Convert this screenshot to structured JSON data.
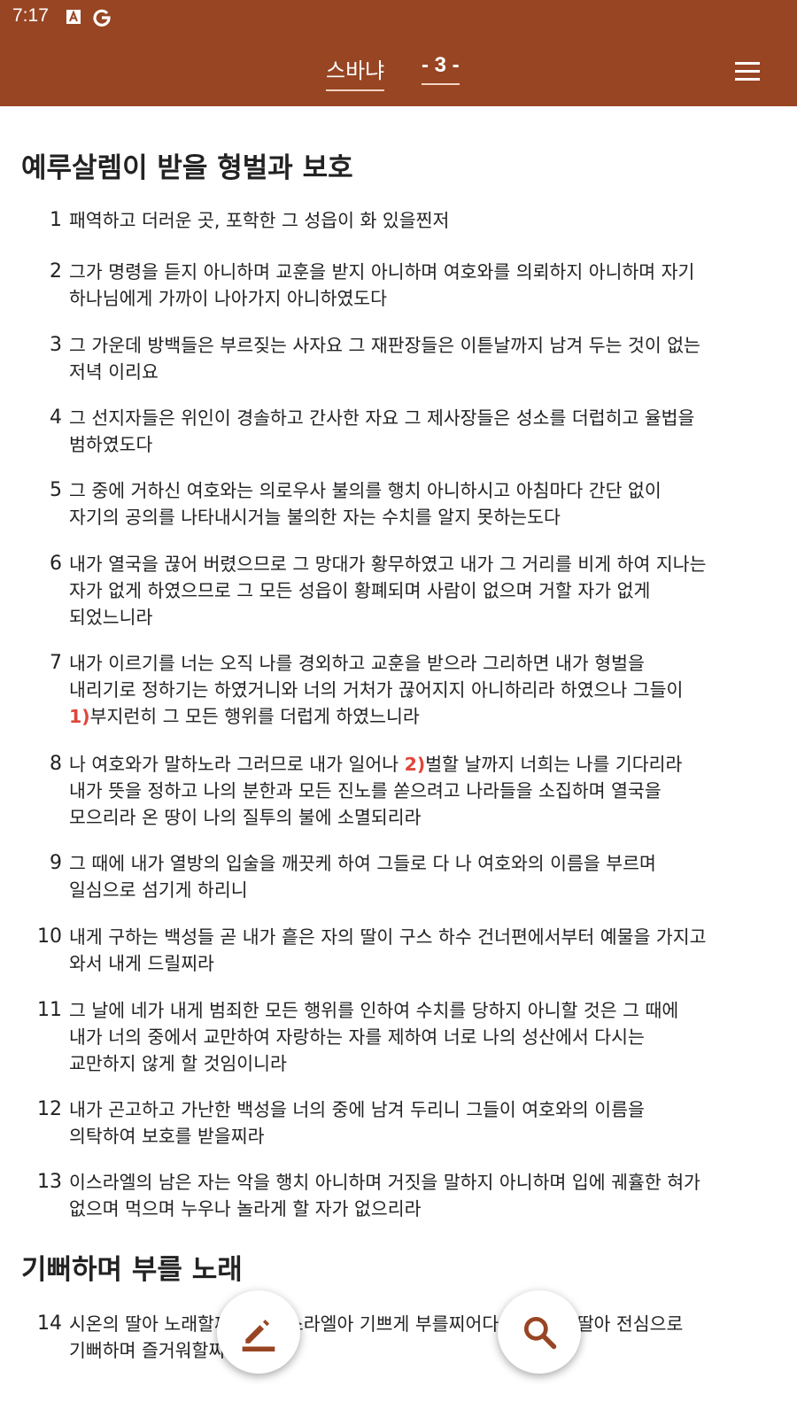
{
  "status_bar": {
    "time": "7:17"
  },
  "header": {
    "book": "스바냐",
    "chapter": "- 3 -"
  },
  "sections": [
    {
      "heading": "예루살렘이 받을 형벌과 보호",
      "verses": [
        {
          "num": "1",
          "lines": [
            "패역하고 더러운 곳, 포학한 그 성읍이 화 있을찐저"
          ]
        },
        {
          "num": "2",
          "lines": [
            "그가 명령을 듣지 아니하며 교훈을 받지 아니하며 여호와를 의뢰하지 아니하며 자기",
            "하나님에게 가까이 나아가지 아니하였도다"
          ]
        },
        {
          "num": "3",
          "lines": [
            "그 가운데 방백들은 부르짖는 사자요 그 재판장들은 이튿날까지 남겨 두는 것이 없는",
            "저녁 이리요"
          ]
        },
        {
          "num": "4",
          "lines": [
            "그 선지자들은 위인이 경솔하고 간사한 자요 그 제사장들은 성소를 더럽히고 율법을",
            "범하였도다"
          ]
        },
        {
          "num": "5",
          "lines": [
            "그 중에 거하신 여호와는 의로우사 불의를 행치 아니하시고 아침마다 간단 없이",
            "자기의 공의를 나타내시거늘 불의한 자는 수치를 알지 못하는도다"
          ]
        },
        {
          "num": "6",
          "lines": [
            "내가 열국을 끊어 버렸으므로 그 망대가 황무하였고 내가 그 거리를 비게 하여 지나는",
            "자가 없게 하였으므로 그 모든 성읍이 황폐되며 사람이 없으며 거할 자가 없게",
            "되었느니라"
          ]
        },
        {
          "num": "7",
          "lines": [
            "내가 이르기를 너는 오직 나를 경외하고 교훈을 받으라 그리하면 내가 형벌을",
            "내리기로 정하기는 하였거니와 너의 거처가 끊어지지 아니하리라 하였으나 그들이"
          ],
          "fn_mark": "1)",
          "fn_line": "부지런히 그 모든 행위를 더럽게 하였느니라"
        },
        {
          "num": "8",
          "pre": "나 여호와가 말하노라 그러므로 내가 일어나 ",
          "fn_mark": "2)",
          "post": "벌할 날까지 너희는 나를 기다리라",
          "lines": [
            "내가 뜻을 정하고 나의 분한과 모든 진노를 쏟으려고 나라들을 소집하며 열국을",
            "모으리라 온 땅이 나의 질투의 불에 소멸되리라"
          ]
        },
        {
          "num": "9",
          "lines": [
            "그 때에 내가 열방의 입술을 깨끗케 하여 그들로 다 나 여호와의 이름을 부르며",
            "일심으로 섬기게 하리니"
          ]
        },
        {
          "num": "10",
          "lines": [
            "내게 구하는 백성들 곧 내가 흩은 자의 딸이 구스 하수 건너편에서부터 예물을 가지고",
            "와서 내게 드릴찌라"
          ]
        },
        {
          "num": "11",
          "lines": [
            "그 날에 네가 내게 범죄한 모든 행위를 인하여 수치를 당하지 아니할 것은 그 때에",
            "내가 너의 중에서 교만하여 자랑하는 자를 제하여 너로 나의 성산에서 다시는",
            "교만하지 않게 할 것임이니라"
          ]
        },
        {
          "num": "12",
          "lines": [
            "내가 곤고하고 가난한 백성을 너의 중에 남겨 두리니 그들이 여호와의 이름을",
            "의탁하여 보호를 받을찌라"
          ]
        },
        {
          "num": "13",
          "lines": [
            "이스라엘의 남은 자는 악을 행치 아니하며 거짓을 말하지 아니하며 입에 궤휼한 혀가",
            "없으며 먹으며 누우나 놀라게 할 자가 없으리라"
          ]
        }
      ]
    },
    {
      "heading": "기뻐하며 부를 노래",
      "verses": [
        {
          "num": "14",
          "lines": [
            "시온의 딸아 노래할찌어다 이스라엘아 기쁘게 부를찌어다 예루살렘 딸아 전심으로",
            "기뻐하며 즐거워할찌어다"
          ]
        }
      ]
    }
  ],
  "colors": {
    "appbar": "#984523",
    "footnote": "#e0463a",
    "fab_icon": "#984523"
  },
  "fabs": {
    "left": "edit-icon",
    "right": "search-icon"
  }
}
